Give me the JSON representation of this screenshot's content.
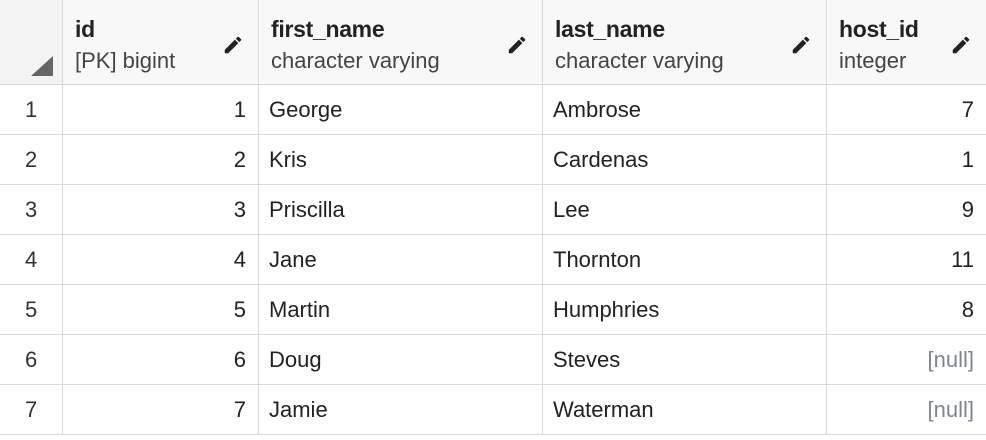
{
  "columns": [
    {
      "name": "id",
      "type": "[PK] bigint"
    },
    {
      "name": "first_name",
      "type": "character varying"
    },
    {
      "name": "last_name",
      "type": "character varying"
    },
    {
      "name": "host_id",
      "type": "integer"
    }
  ],
  "rows": [
    {
      "num": "1",
      "id": "1",
      "first_name": "George",
      "last_name": "Ambrose",
      "host_id": "7"
    },
    {
      "num": "2",
      "id": "2",
      "first_name": "Kris",
      "last_name": "Cardenas",
      "host_id": "1"
    },
    {
      "num": "3",
      "id": "3",
      "first_name": "Priscilla",
      "last_name": "Lee",
      "host_id": "9"
    },
    {
      "num": "4",
      "id": "4",
      "first_name": "Jane",
      "last_name": "Thornton",
      "host_id": "11"
    },
    {
      "num": "5",
      "id": "5",
      "first_name": "Martin",
      "last_name": "Humphries",
      "host_id": "8"
    },
    {
      "num": "6",
      "id": "6",
      "first_name": "Doug",
      "last_name": "Steves",
      "host_id": "[null]"
    },
    {
      "num": "7",
      "id": "7",
      "first_name": "Jamie",
      "last_name": "Waterman",
      "host_id": "[null]"
    }
  ],
  "icons": {
    "edit": "pencil-icon",
    "select_all": "select-all-corner-icon"
  }
}
